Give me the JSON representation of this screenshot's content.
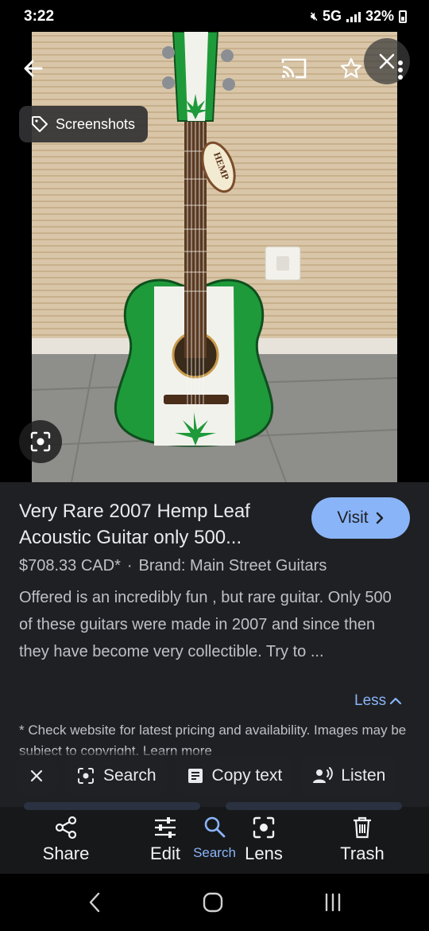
{
  "status": {
    "time": "3:22",
    "network": "5G",
    "battery": "32%"
  },
  "image": {
    "chip_label": "Screenshots",
    "hang_tag_text": "HEMP"
  },
  "result": {
    "title": "Very Rare 2007 Hemp Leaf Acoustic Guitar only 500...",
    "visit_label": "Visit",
    "price": "$708.33 CAD*",
    "separator": "·",
    "brand": "Brand: Main Street Guitars",
    "description": "Offered is an incredibly fun , but rare guitar. Only 500 of these guitars were made in 2007 and since then they have become very collectible. Try to ...",
    "less_label": "Less",
    "disclaimer": "* Check website for latest pricing and availability. Images may be subject to copyright. Learn more"
  },
  "actions": {
    "search_label": "Search",
    "copy_text_label": "Copy text",
    "listen_label": "Listen"
  },
  "toolbar": {
    "share_label": "Share",
    "edit_label": "Edit",
    "search_label": "Search",
    "lens_label": "Lens",
    "trash_label": "Trash"
  },
  "colors": {
    "accent": "#8ab4f8",
    "panel_bg": "#1f2023",
    "guitar_green": "#1f9a3a"
  }
}
